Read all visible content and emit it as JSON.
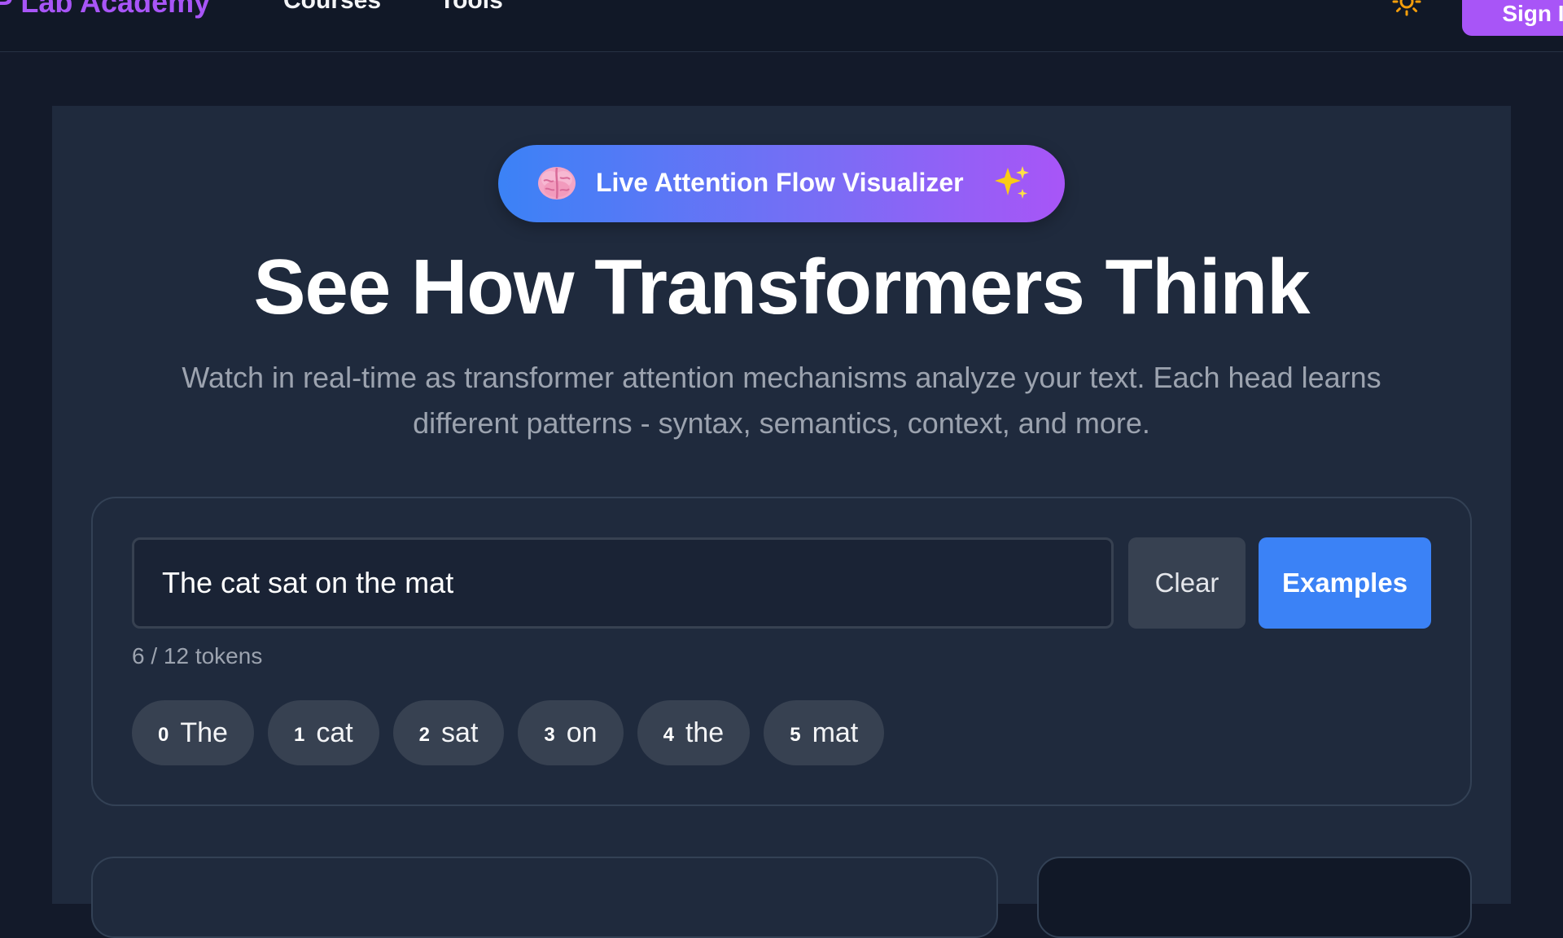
{
  "nav": {
    "brand": "P Lab Academy",
    "links": [
      "Courses",
      "Tools"
    ],
    "theme_icon": "sun-icon",
    "signin_label": "Sign In"
  },
  "hero": {
    "badge_emoji": "brain-icon",
    "badge_label": "Live Attention Flow Visualizer",
    "badge_sparkle": "sparkles-icon",
    "title": "See How Transformers Think",
    "subtitle": "Watch in real-time as transformer attention mechanisms analyze your text. Each head learns different patterns - syntax, semantics, context, and more."
  },
  "input": {
    "value": "The cat sat on the mat",
    "clear_label": "Clear",
    "examples_label": "Examples",
    "token_count": "6 / 12 tokens"
  },
  "tokens": [
    {
      "index": "0",
      "text": "The"
    },
    {
      "index": "1",
      "text": "cat"
    },
    {
      "index": "2",
      "text": "sat"
    },
    {
      "index": "3",
      "text": "on"
    },
    {
      "index": "4",
      "text": "the"
    },
    {
      "index": "5",
      "text": "mat"
    }
  ],
  "colors": {
    "accent_purple": "#a855f7",
    "accent_blue": "#3b82f6",
    "background": "#131a2a",
    "panel": "#1f2a3d"
  }
}
